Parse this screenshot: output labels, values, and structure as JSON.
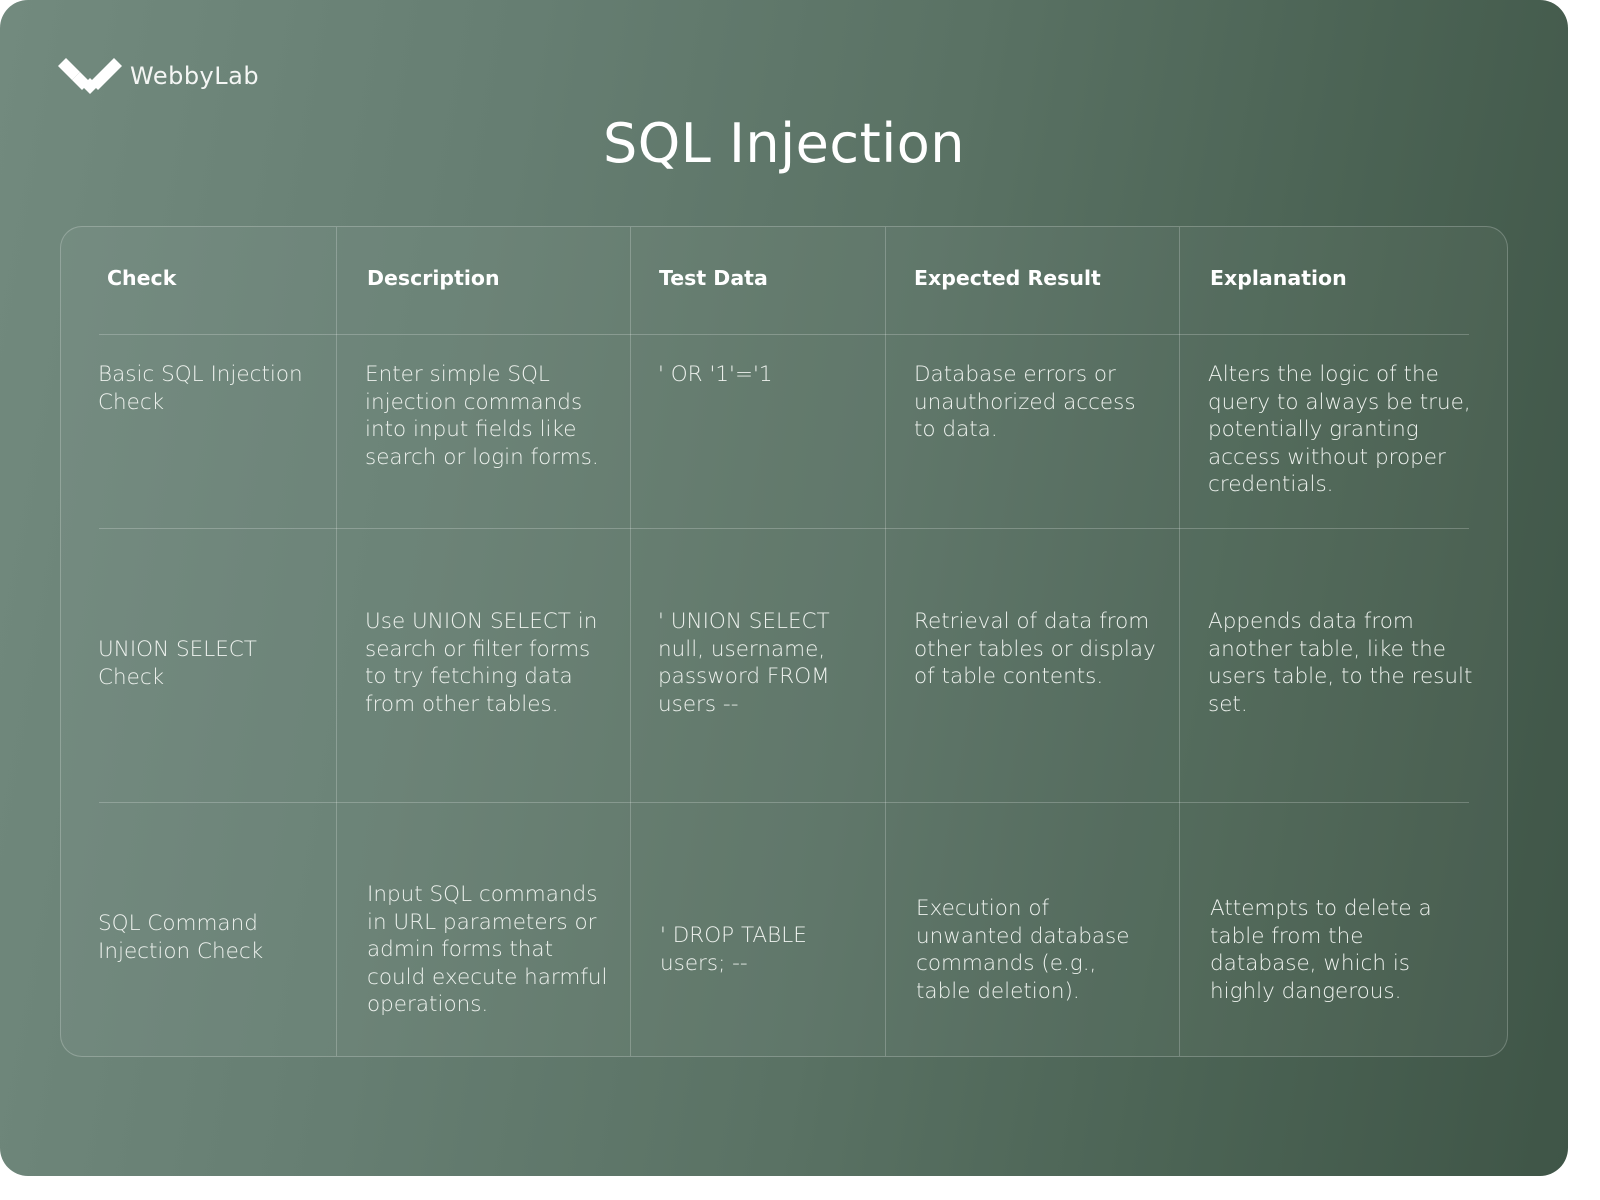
{
  "brand": {
    "logo_icon": "webbylab-logo-icon",
    "name": "WebbyLab"
  },
  "title": "SQL Injection",
  "table": {
    "headers": [
      "Check",
      "Description",
      "Test Data",
      "Expected Result",
      "Explanation"
    ],
    "rows": [
      {
        "check": "Basic SQL Injection Check",
        "description": "Enter simple SQL injection commands into input fields like search or login forms.",
        "test_data": "' OR '1'='1",
        "expected_result": "Database errors or unauthorized access to data.",
        "explanation": "Alters the logic of the query to always be true, potentially granting access without proper credentials."
      },
      {
        "check": "UNION SELECT Check",
        "description": "Use UNION SELECT in search or filter forms to try fetching data from other tables.",
        "test_data": "' UNION SELECT null, username, password FROM users --",
        "expected_result": "Retrieval of data from other tables or display of table contents.",
        "explanation": "Appends data from another table, like the users table, to the result set."
      },
      {
        "check": "SQL Command Injection Check",
        "description": "Input SQL commands in URL parameters or admin forms that could execute harmful operations.",
        "test_data": "' DROP TABLE users; --",
        "expected_result": "Execution of unwanted database commands (e.g., table deletion).",
        "explanation": "Attempts to delete a table from the database, which is highly dangerous."
      }
    ]
  }
}
